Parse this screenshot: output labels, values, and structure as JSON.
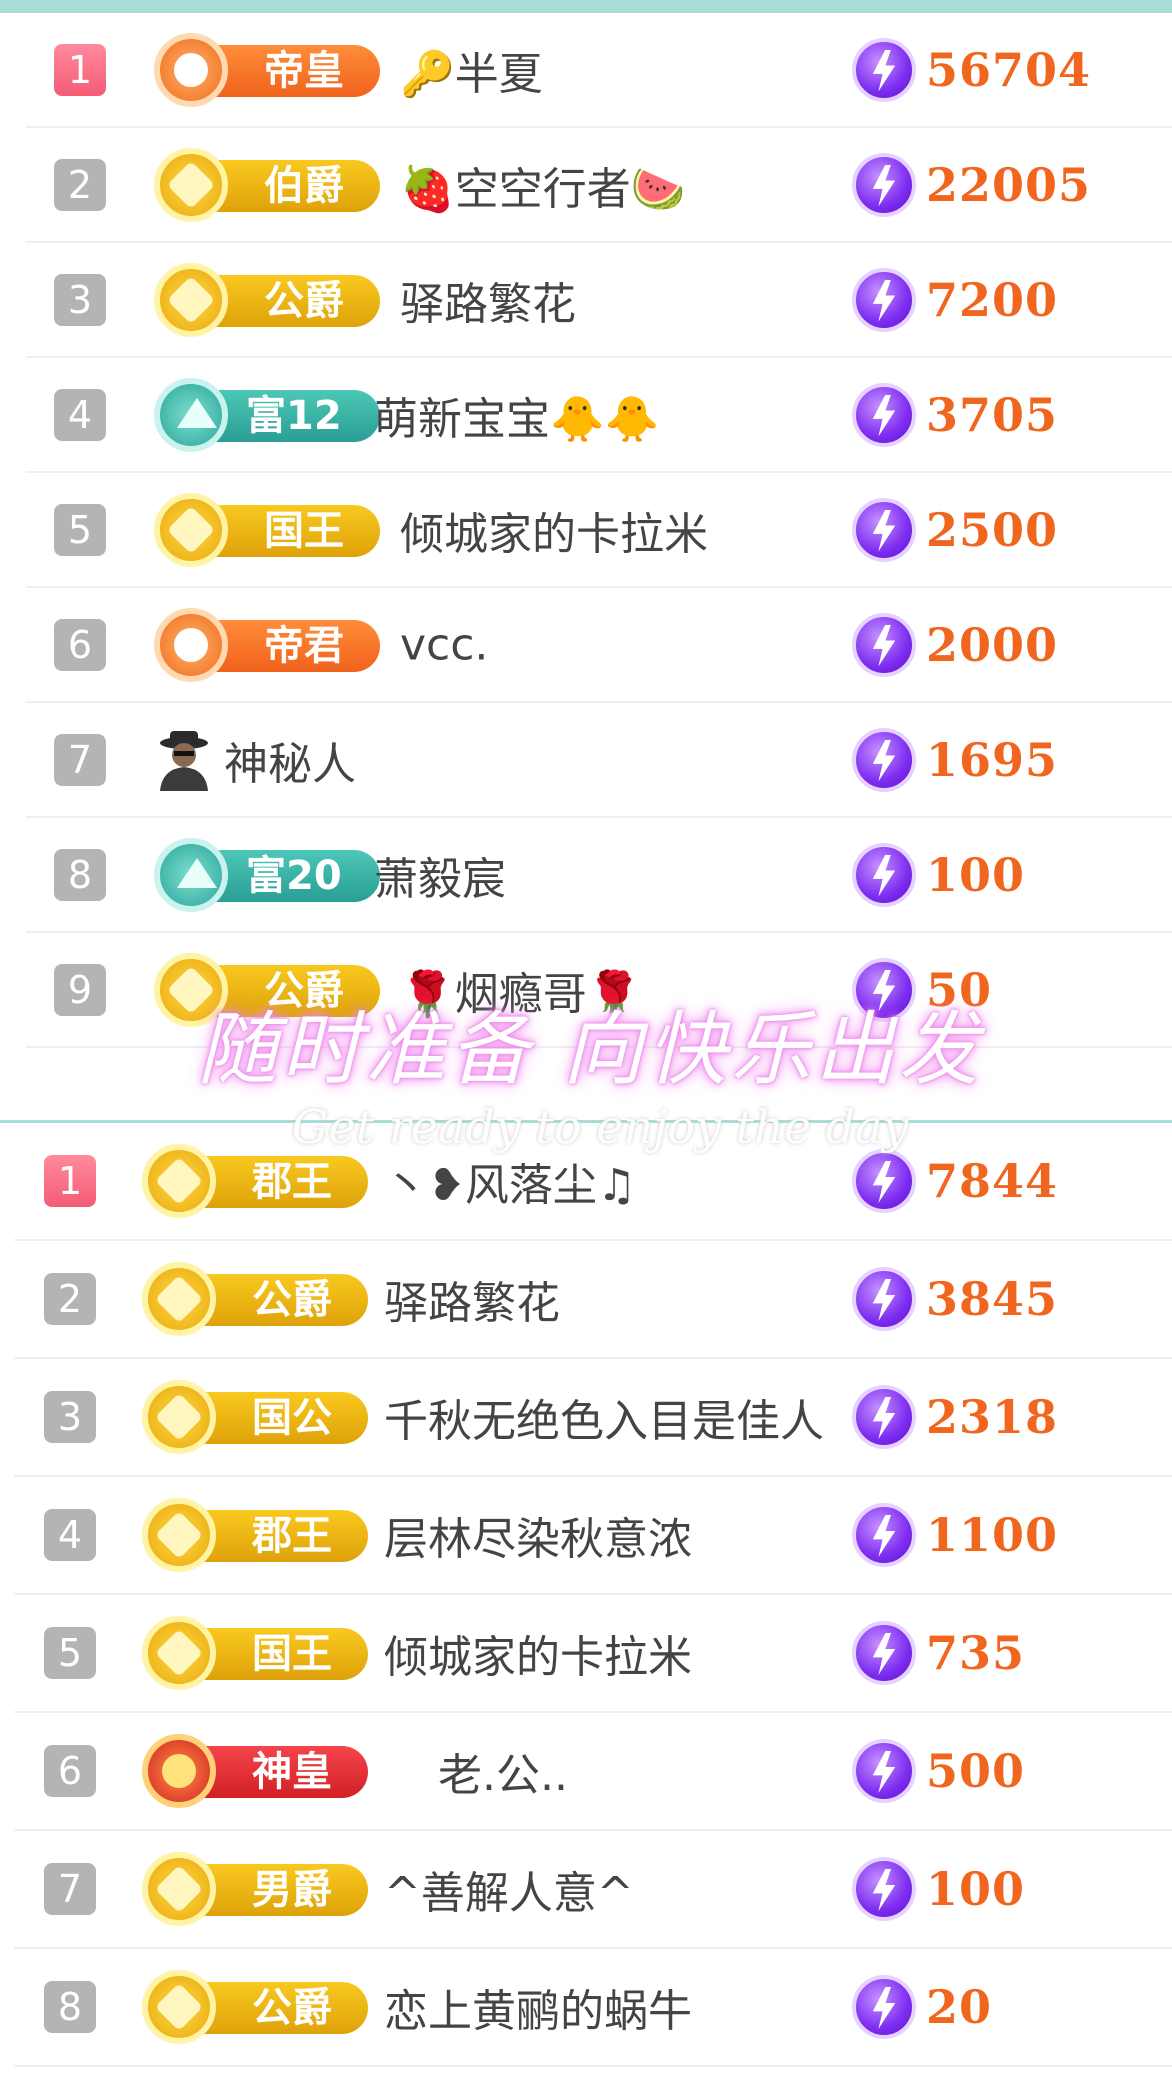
{
  "colors": {
    "accent_bar": "#a8dcd6",
    "score": "#f0661f",
    "rank_top": "#f45c74",
    "rank_default": "#b4b4b4",
    "energy": "#7d2df0"
  },
  "leaderboard_1": [
    {
      "rank": "1",
      "rank_style": "gold",
      "badge_type": "orange",
      "badge": "帝皇",
      "name": "🔑半夏",
      "score": "56704"
    },
    {
      "rank": "2",
      "rank_style": "gray",
      "badge_type": "gold",
      "badge": "伯爵",
      "name": "🍓空空行者🍉",
      "score": "22005"
    },
    {
      "rank": "3",
      "rank_style": "gray",
      "badge_type": "gold",
      "badge": "公爵",
      "name": "驿路繁花",
      "score": "7200"
    },
    {
      "rank": "4",
      "rank_style": "gray",
      "badge_type": "teal",
      "badge": "富12",
      "name": "萌新宝宝🐥🐥",
      "score": "3705"
    },
    {
      "rank": "5",
      "rank_style": "gray",
      "badge_type": "gold",
      "badge": "国王",
      "name": "倾城家的卡拉米",
      "score": "2500"
    },
    {
      "rank": "6",
      "rank_style": "gray",
      "badge_type": "orange",
      "badge": "帝君",
      "name": "vcc.",
      "score": "2000"
    },
    {
      "rank": "7",
      "rank_style": "gray",
      "badge_type": "avatar",
      "badge": "",
      "name": "神秘人",
      "score": "1695"
    },
    {
      "rank": "8",
      "rank_style": "gray",
      "badge_type": "teal",
      "badge": "富20",
      "name": "萧毅宸",
      "score": "100"
    },
    {
      "rank": "9",
      "rank_style": "gray",
      "badge_type": "gold",
      "badge": "公爵",
      "name": "🌹烟瘾哥🌹",
      "score": "50"
    }
  ],
  "leaderboard_2": [
    {
      "rank": "1",
      "rank_style": "gold",
      "badge_type": "gold",
      "badge": "郡王",
      "name": "丶❥风落尘♫",
      "score": "7844"
    },
    {
      "rank": "2",
      "rank_style": "gray",
      "badge_type": "gold",
      "badge": "公爵",
      "name": "驿路繁花",
      "score": "3845"
    },
    {
      "rank": "3",
      "rank_style": "gray",
      "badge_type": "gold",
      "badge": "国公",
      "name": "千秋无绝色入目是佳人",
      "score": "2318"
    },
    {
      "rank": "4",
      "rank_style": "gray",
      "badge_type": "gold",
      "badge": "郡王",
      "name": "层林尽染秋意浓",
      "score": "1100"
    },
    {
      "rank": "5",
      "rank_style": "gray",
      "badge_type": "gold",
      "badge": "国王",
      "name": "倾城家的卡拉米",
      "score": "735"
    },
    {
      "rank": "6",
      "rank_style": "gray",
      "badge_type": "red",
      "badge": "神皇",
      "name": "老.公..",
      "score": "500"
    },
    {
      "rank": "7",
      "rank_style": "gray",
      "badge_type": "gold",
      "badge": "男爵",
      "name": "^善解人意^",
      "score": "100"
    },
    {
      "rank": "8",
      "rank_style": "gray",
      "badge_type": "gold",
      "badge": "公爵",
      "name": "恋上黄鹂的蜗牛",
      "score": "20"
    }
  ],
  "watermark": {
    "main": "随时准备 向快乐出发",
    "sub": "Get ready to enjoy the day"
  }
}
